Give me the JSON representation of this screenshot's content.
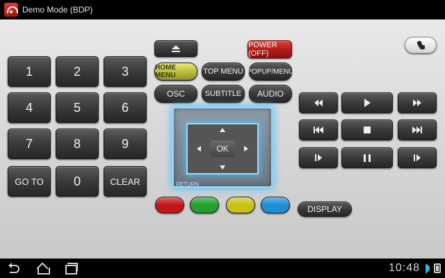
{
  "titlebar": {
    "title": "Demo Mode (BDP)"
  },
  "numpad": {
    "k1": "1",
    "k2": "2",
    "k3": "3",
    "k4": "4",
    "k5": "5",
    "k6": "6",
    "k7": "7",
    "k8": "8",
    "k9": "9",
    "goto": "GO TO",
    "k0": "0",
    "clear": "CLEAR"
  },
  "menu": {
    "power": "POWER (OFF)",
    "home_menu": "HOME MENU",
    "top_menu": "TOP MENU",
    "popup_menu": "POPUP/MENU",
    "osc": "OSC",
    "subtitle": "SUBTITLE",
    "audio": "AUDIO"
  },
  "dpad": {
    "ok": "OK",
    "return": "RETURN"
  },
  "color_buttons": {
    "red": "#c4151a",
    "green": "#23a02c",
    "yellow": "#c9c215",
    "blue": "#1c8fd6"
  },
  "display": "DISPLAY",
  "navbar": {
    "time": "10:48"
  },
  "icons": [
    "eject-icon",
    "hand-pointer-icon",
    "rewind-icon",
    "play-icon",
    "fast-forward-icon",
    "skip-back-icon",
    "stop-icon",
    "skip-forward-icon",
    "step-back-icon",
    "pause-icon",
    "step-forward-icon",
    "back-icon",
    "home-icon",
    "recents-icon",
    "wifi-icon",
    "battery-icon"
  ]
}
